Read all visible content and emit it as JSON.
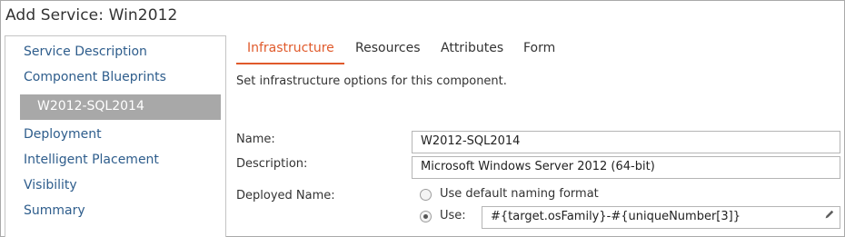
{
  "window": {
    "title": "Add Service: Win2012"
  },
  "sidebar": {
    "items": [
      {
        "label": "Service Description"
      },
      {
        "label": "Component Blueprints"
      },
      {
        "label": "W2012-SQL2014"
      },
      {
        "label": "Deployment"
      },
      {
        "label": "Intelligent Placement"
      },
      {
        "label": "Visibility"
      },
      {
        "label": "Summary"
      }
    ],
    "selected": "W2012-SQL2014"
  },
  "tabs": [
    {
      "label": "Infrastructure",
      "active": true
    },
    {
      "label": "Resources",
      "active": false
    },
    {
      "label": "Attributes",
      "active": false
    },
    {
      "label": "Form",
      "active": false
    }
  ],
  "help_text": "Set infrastructure options for this component.",
  "form": {
    "name_label": "Name:",
    "name_value": "W2012-SQL2014",
    "description_label": "Description:",
    "description_value": "Microsoft Windows Server 2012 (64-bit)",
    "deployed_name_label": "Deployed Name:",
    "option_default_label": "Use default naming format",
    "option_default_selected": false,
    "option_use_label": "Use:",
    "option_use_selected": true,
    "naming_format_value": "#{target.osFamily}-#{uniqueNumber[3]}"
  },
  "colors": {
    "accent": "#e05a2b",
    "link": "#2e5d8c",
    "selected_bg": "#a8a8a8"
  },
  "icons": {
    "edit": "pencil-icon"
  }
}
